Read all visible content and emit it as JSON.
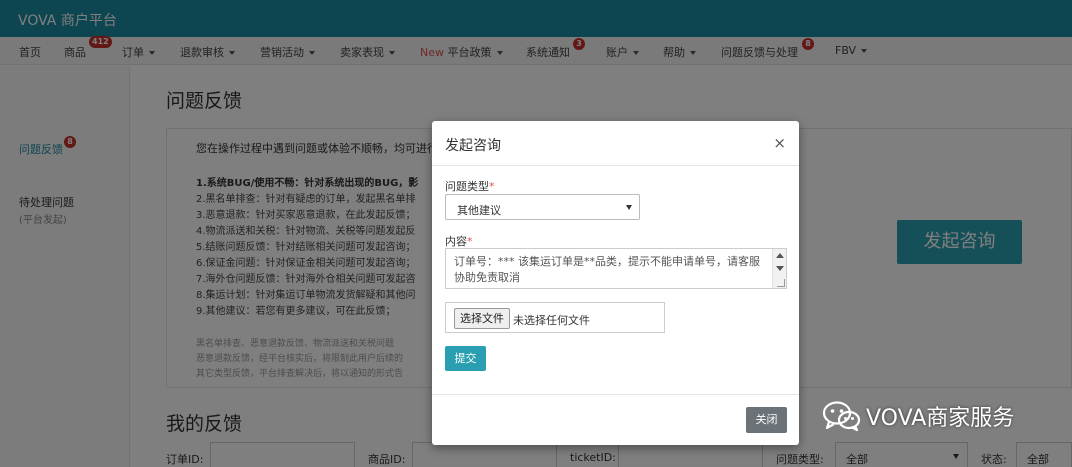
{
  "app": {
    "brand": "VOVA 商户平台"
  },
  "nav": {
    "items": [
      {
        "label": "首页"
      },
      {
        "label": "商品",
        "badge": "412"
      },
      {
        "label": "订单"
      },
      {
        "label": "退款审核"
      },
      {
        "label": "营销活动"
      },
      {
        "label": "卖家表现"
      },
      {
        "new": "New",
        "label": "平台政策"
      },
      {
        "label": "系统通知",
        "badge": "3"
      },
      {
        "label": "账户"
      },
      {
        "label": "帮助"
      },
      {
        "label": "问题反馈与处理",
        "badge": "8"
      },
      {
        "label": "FBV"
      }
    ]
  },
  "sidebar": {
    "feedback": "问题反馈",
    "feedback_badge": "8",
    "pending": "待处理问题",
    "pending_sub": "(平台发起)"
  },
  "main": {
    "title": "问题反馈",
    "intro": "您在操作过程中遇到问题或体验不顺畅，均可进行",
    "categories": [
      "1.系统BUG/使用不畅：针对系统出现的BUG，影",
      "2.黑名单排查：针对有疑虑的订单，发起黑名单排",
      "3.恶意退款：针对买家恶意退款，在此发起反馈；",
      "4.物流派送和关税：针对物流、关税等问题发起反",
      "5.结账问题反馈：针对结账相关问题可发起咨询；",
      "6.保证金问题：针对保证金相关问题可发起咨询；",
      "7.海外仓问题反馈：针对海外仓相关问题可发起咨",
      "8.集运计划：针对集运订单物流发货解疑和其他问",
      "9.其他建议：若您有更多建议，可在此反馈；"
    ],
    "notes": [
      "黑名单排查、恶意退款反馈、物流派送和关税问题",
      "恶意退款反馈，经平台核实后，将限制此用户后续的",
      "其它类型反馈，平台排查解决后，将以通知的形式告"
    ],
    "start_button": "发起咨询",
    "my_title": "我的反馈"
  },
  "filters": {
    "order_id": "订单ID:",
    "product_id": "商品ID:",
    "ticket_id": "ticketID:",
    "issue_type": "问题类型:",
    "issue_type_value": "全部",
    "status": "状态:",
    "status_value": "全部"
  },
  "modal": {
    "title": "发起咨询",
    "close_x": "×",
    "type_label": "问题类型",
    "required": "*",
    "type_value": "其他建议",
    "content_label": "内容",
    "content_value": "订单号：*** 该集运订单是**品类，提示不能申请单号，请客服协助免责取消",
    "file_button": "选择文件",
    "file_status": "未选择任何文件",
    "submit": "提交",
    "close": "关闭"
  },
  "watermark": {
    "text": "VOVA商家服务"
  }
}
